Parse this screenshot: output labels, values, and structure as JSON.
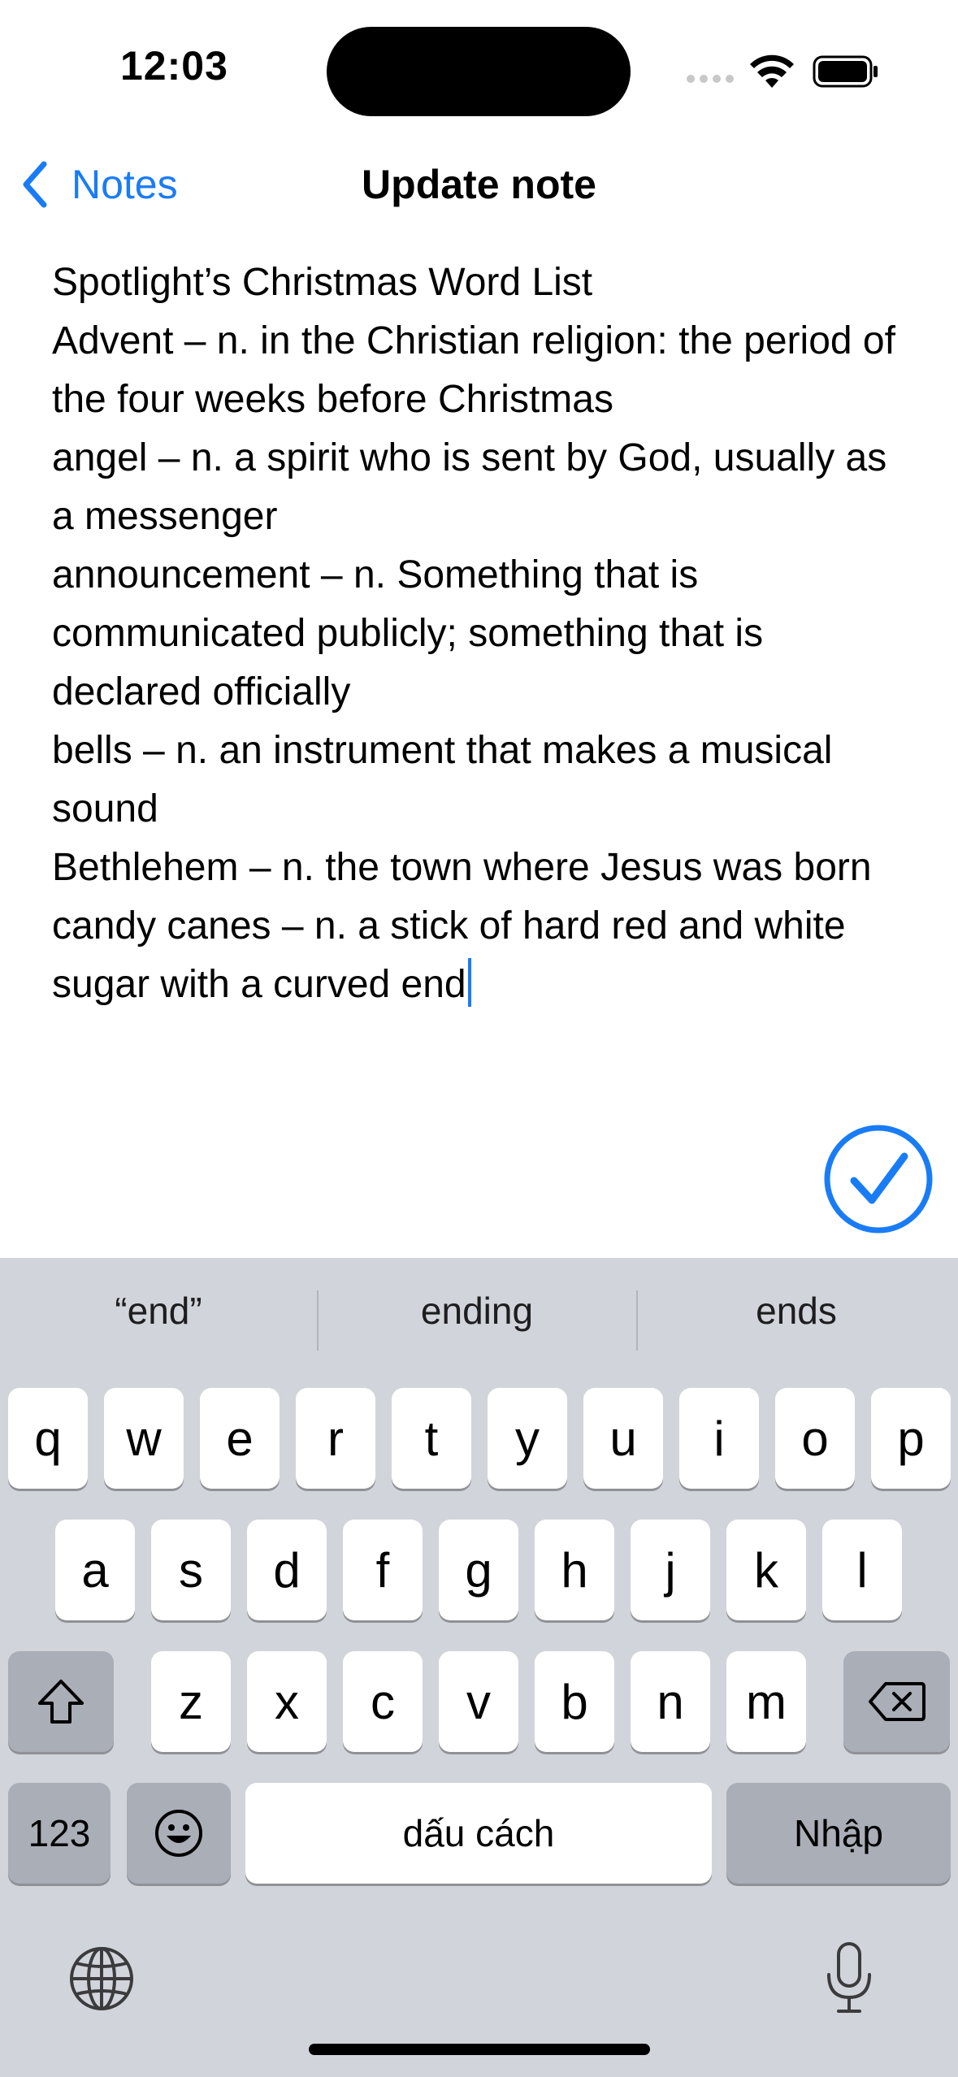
{
  "status_bar": {
    "time": "12:03"
  },
  "nav": {
    "back_label": "Notes",
    "title": "Update note"
  },
  "note": {
    "lines": [
      "Spotlight’s Christmas Word List",
      "Advent – n. in the Christian religion: the period of the four weeks before Christmas",
      "angel – n. a spirit who is sent by God, usually as a messenger",
      "announcement – n. Something that is communicated publicly; something that is declared officially",
      "bells – n. an instrument that makes a musical sound",
      "Bethlehem – n. the town where Jesus was born",
      "candy canes – n. a stick of hard red and white sugar with a curved end"
    ]
  },
  "colors": {
    "accent": "#1a7cf5",
    "keyboard_bg": "#d1d4da",
    "key_dark": "#a9aeb7"
  },
  "keyboard": {
    "suggestions": [
      "“end”",
      "ending",
      "ends"
    ],
    "row1": [
      "q",
      "w",
      "e",
      "r",
      "t",
      "y",
      "u",
      "i",
      "o",
      "p"
    ],
    "row2": [
      "a",
      "s",
      "d",
      "f",
      "g",
      "h",
      "j",
      "k",
      "l"
    ],
    "row3": [
      "z",
      "x",
      "c",
      "v",
      "b",
      "n",
      "m"
    ],
    "numbers_label": "123",
    "space_label": "dấu cách",
    "return_label": "Nhập",
    "icons": [
      "shift-icon",
      "backspace-icon",
      "emoji-icon",
      "globe-icon",
      "microphone-icon"
    ]
  }
}
